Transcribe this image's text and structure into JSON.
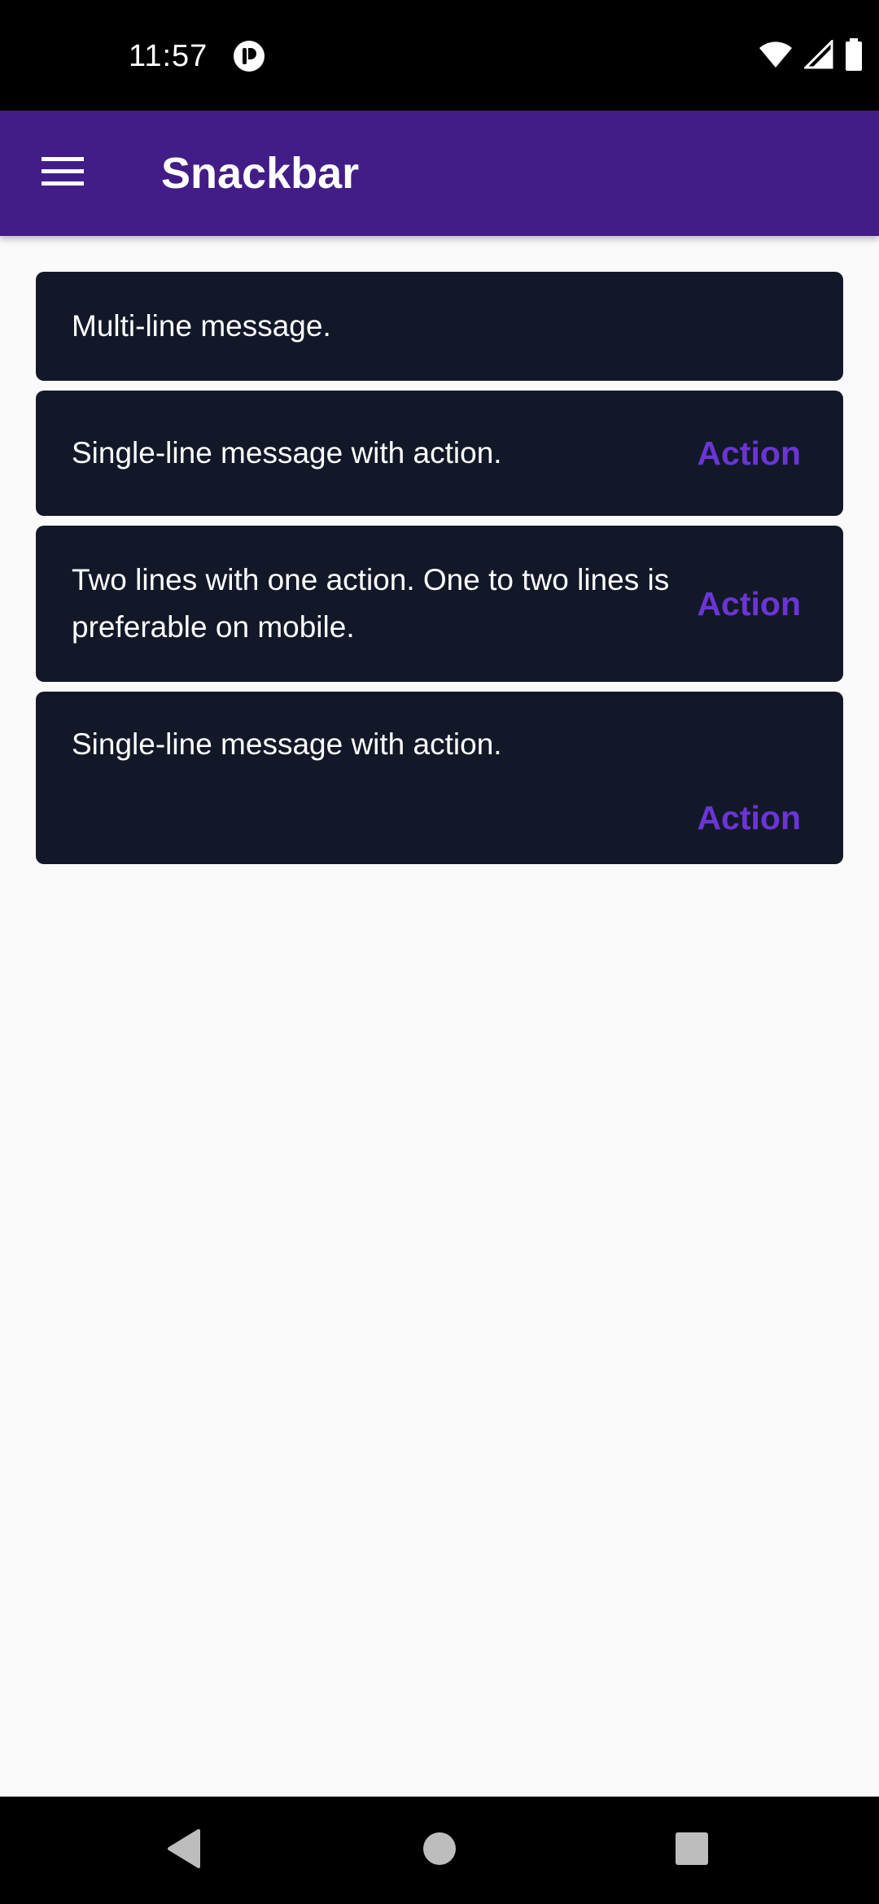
{
  "status_bar": {
    "time": "11:57",
    "icons": [
      "app-notification-icon",
      "wifi-icon",
      "cell-signal-icon",
      "battery-icon"
    ]
  },
  "app_bar": {
    "title": "Snackbar",
    "menu_icon": "menu-icon",
    "background": "#431d87"
  },
  "snackbars": [
    {
      "message": "Multi-line message."
    },
    {
      "message": "Single-line message with action.",
      "action": "Action"
    },
    {
      "message": "Two lines with one action. One to two lines is preferable on mobile.",
      "action": "Action"
    },
    {
      "message": "Single-line message with action.",
      "action": "Action"
    }
  ],
  "colors": {
    "snackbar_background": "#131829",
    "action_text": "#6b35d6",
    "page_background": "#fafafa"
  },
  "navigation_bar": {
    "buttons": [
      "back-icon",
      "home-icon",
      "recents-icon"
    ]
  }
}
